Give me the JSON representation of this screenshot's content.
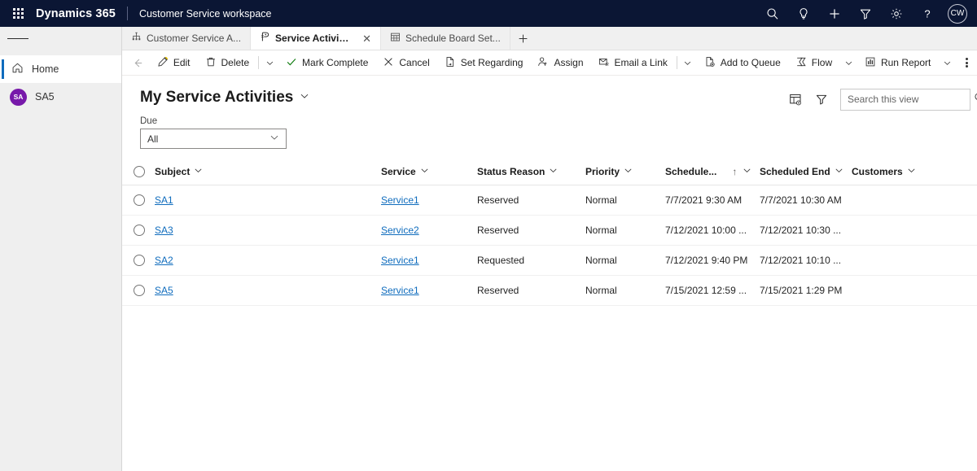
{
  "topnav": {
    "waffle_icon": "app-launcher-icon",
    "brand": "Dynamics 365",
    "app_name": "Customer Service workspace",
    "icons": [
      {
        "name": "search-icon",
        "label": "Search"
      },
      {
        "name": "lightbulb-icon",
        "label": "Insights"
      },
      {
        "name": "plus-icon",
        "label": "Quick create"
      },
      {
        "name": "filter-icon",
        "label": "Filter"
      },
      {
        "name": "gear-icon",
        "label": "Settings"
      },
      {
        "name": "help-icon",
        "label": "Help"
      }
    ],
    "avatar_initials": "CW"
  },
  "tabs": [
    {
      "label": "Customer Service A...",
      "icon": "sitemap-icon",
      "active": false,
      "closable": false
    },
    {
      "label": "Service Activities My Ser...",
      "icon": "service-activity-icon",
      "active": true,
      "closable": true
    },
    {
      "label": "Schedule Board Set...",
      "icon": "calendar-grid-icon",
      "active": false,
      "closable": false
    }
  ],
  "tab_add_label": "+",
  "sidebar": {
    "hamburger_icon": "hamburger-menu-icon",
    "items": [
      {
        "label": "Home",
        "icon": "home-icon",
        "selected": true,
        "type": "nav"
      },
      {
        "label": "SA5",
        "initials": "SA",
        "selected": false,
        "type": "session"
      }
    ]
  },
  "commandbar": {
    "back_icon": "back-arrow-icon",
    "items": [
      {
        "label": "Edit",
        "icon": "pencil-icon",
        "type": "button"
      },
      {
        "label": "Delete",
        "icon": "trash-icon",
        "type": "button"
      },
      {
        "type": "divider"
      },
      {
        "type": "chevron"
      },
      {
        "label": "Mark Complete",
        "icon": "checkmark-icon",
        "type": "button"
      },
      {
        "label": "Cancel",
        "icon": "close-x-icon",
        "type": "button"
      },
      {
        "label": "Set Regarding",
        "icon": "document-link-icon",
        "type": "button"
      },
      {
        "label": "Assign",
        "icon": "person-add-icon",
        "type": "button"
      },
      {
        "label": "Email a Link",
        "icon": "email-link-icon",
        "type": "button"
      },
      {
        "type": "divider"
      },
      {
        "type": "chevron"
      },
      {
        "label": "Add to Queue",
        "icon": "add-queue-icon",
        "type": "button"
      },
      {
        "label": "Flow",
        "icon": "flow-icon",
        "type": "button"
      },
      {
        "type": "chevron"
      },
      {
        "label": "Run Report",
        "icon": "report-icon",
        "type": "button"
      },
      {
        "type": "chevron"
      }
    ],
    "overflow_label": "More commands"
  },
  "view": {
    "title": "My Service Activities",
    "title_chevron_icon": "chevron-down-icon",
    "toolbar_icons": [
      {
        "name": "edit-columns-icon",
        "label": "Edit columns"
      },
      {
        "name": "edit-filters-icon",
        "label": "Edit filters"
      }
    ],
    "search": {
      "placeholder": "Search this view",
      "value": "",
      "icon": "search-icon"
    }
  },
  "due_filter": {
    "label": "Due",
    "value": "All",
    "chevron_icon": "chevron-down-icon"
  },
  "grid": {
    "select_all_name": "select-all-radio",
    "columns": [
      {
        "label": "Subject",
        "sorted": false
      },
      {
        "label": "Service",
        "sorted": false
      },
      {
        "label": "Status Reason",
        "sorted": false
      },
      {
        "label": "Priority",
        "sorted": false
      },
      {
        "label": "Schedule...",
        "sorted": true,
        "sort_dir": "↑"
      },
      {
        "label": "Scheduled End",
        "sorted": false
      },
      {
        "label": "Customers",
        "sorted": false
      }
    ],
    "rows": [
      {
        "subject": "SA1",
        "service": "Service1",
        "status_reason": "Reserved",
        "priority": "Normal",
        "scheduled_start": "7/7/2021 9:30 AM",
        "scheduled_end": "7/7/2021 10:30 AM",
        "customers": ""
      },
      {
        "subject": "SA3",
        "service": "Service2",
        "status_reason": "Reserved",
        "priority": "Normal",
        "scheduled_start": "7/12/2021 10:00 ...",
        "scheduled_end": "7/12/2021 10:30 ...",
        "customers": ""
      },
      {
        "subject": "SA2",
        "service": "Service1",
        "status_reason": "Requested",
        "priority": "Normal",
        "scheduled_start": "7/12/2021 9:40 PM",
        "scheduled_end": "7/12/2021 10:10 ...",
        "customers": ""
      },
      {
        "subject": "SA5",
        "service": "Service1",
        "status_reason": "Reserved",
        "priority": "Normal",
        "scheduled_start": "7/15/2021 12:59 ...",
        "scheduled_end": "7/15/2021 1:29 PM",
        "customers": ""
      }
    ]
  },
  "colors": {
    "nav_bar": "#0b1634",
    "accent_blue": "#0f6cbd",
    "link_blue": "#0f6cbd",
    "avatar_purple": "#7719aa",
    "sidebar_bg": "#efefef",
    "success_green": "#107c10"
  }
}
